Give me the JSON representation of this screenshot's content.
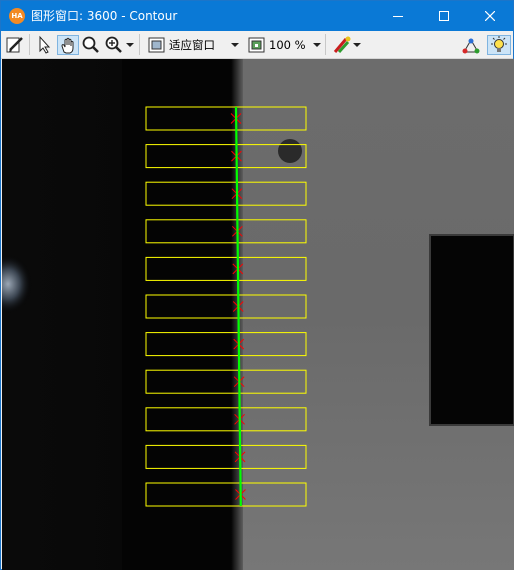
{
  "window": {
    "title": "图形窗口: 3600 - Contour",
    "app_icon_text": "HA"
  },
  "toolbar": {
    "fit_window_label": "适应窗口",
    "zoom_label": "100 %"
  },
  "icons": {
    "edit": "edit-pencil-icon",
    "pointer": "pointer-icon",
    "pan": "hand-pan-icon",
    "magnify": "magnify-icon",
    "zoom": "zoom-in-icon",
    "fit_window": "fit-window-icon",
    "zoom_image": "zoom-image-icon",
    "color_paint": "color-paint-icon",
    "pixel_info": "pixel-info-icon",
    "visualize": "lightbulb-icon"
  },
  "colors": {
    "titlebar": "#0a79d6",
    "roi_rectangle": "#ffff00",
    "edge_line": "#00ff00",
    "edge_marker": "#ff0000"
  },
  "measure_rois_count": 11
}
